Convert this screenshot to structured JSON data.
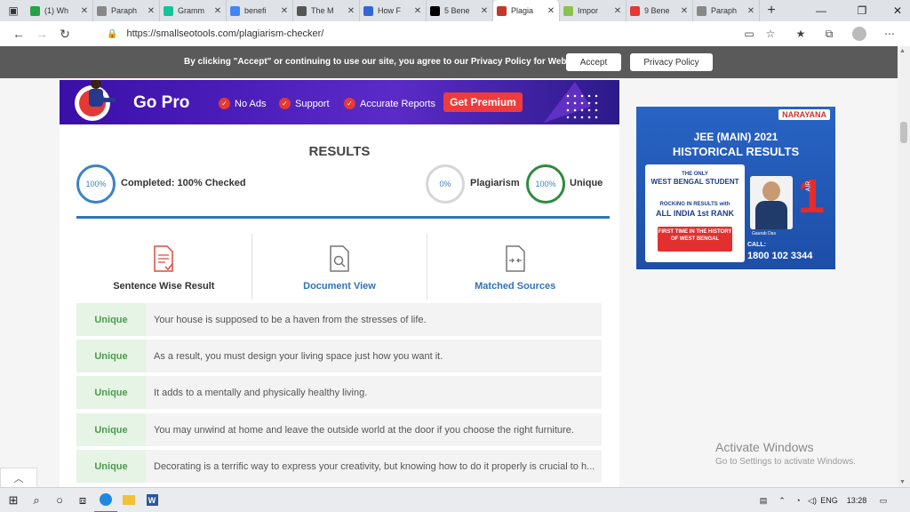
{
  "browser": {
    "tabs": [
      {
        "label": "(1) Wh",
        "favicon": "whatsapp-icon",
        "color": "#25a244"
      },
      {
        "label": "Paraph",
        "favicon": "quill-icon",
        "color": "#888888"
      },
      {
        "label": "Gramm",
        "favicon": "grammarly-icon",
        "color": "#15c39a"
      },
      {
        "label": "benefi",
        "favicon": "google-icon",
        "color": "#4285f4"
      },
      {
        "label": "The M",
        "favicon": "news-icon",
        "color": "#555555"
      },
      {
        "label": "How F",
        "favicon": "globe-icon",
        "color": "#3367d6"
      },
      {
        "label": "5 Bene",
        "favicon": "medium-icon",
        "color": "#000000"
      },
      {
        "label": "Plagia",
        "favicon": "sst-icon",
        "color": "#c0392b"
      },
      {
        "label": "Impor",
        "favicon": "page-icon",
        "color": "#8bc34a"
      },
      {
        "label": "9 Bene",
        "favicon": "target-icon",
        "color": "#e53935"
      },
      {
        "label": "Paraph",
        "favicon": "quill-icon",
        "color": "#888888"
      }
    ],
    "active_tab": 7,
    "new_tab": "+",
    "url": "https://smallseotools.com/plagiarism-checker/"
  },
  "cookie": {
    "message": "By clicking \"Accept\" or continuing to use our site, you agree to our Privacy Policy for Website",
    "accept": "Accept",
    "privacy": "Privacy Policy"
  },
  "gopro": {
    "title": "Go Pro",
    "features": [
      "No Ads",
      "Support",
      "Accurate Reports"
    ],
    "button": "Get Premium"
  },
  "results": {
    "heading": "RESULTS",
    "completed_pct": "100%",
    "completed_label": "Completed: 100% Checked",
    "plagiarism_pct": "0%",
    "plagiarism_label": "Plagiarism",
    "unique_pct": "100%",
    "unique_label": "Unique",
    "views": [
      "Sentence Wise Result",
      "Document View",
      "Matched Sources"
    ],
    "rows": [
      {
        "status": "Unique",
        "text": "Your house is supposed to be a haven from the stresses of life."
      },
      {
        "status": "Unique",
        "text": "As a result, you must design your living space just how you want it."
      },
      {
        "status": "Unique",
        "text": "It adds to a mentally and physically healthy living."
      },
      {
        "status": "Unique",
        "text": "You may unwind at home and leave the outside world at the door if you choose the right furniture."
      },
      {
        "status": "Unique",
        "text": "Decorating is a terrific way to express your creativity, but knowing how to do it properly is crucial to h..."
      }
    ]
  },
  "ad": {
    "brand": "NARAYANA",
    "headline1": "JEE (MAIN) 2021",
    "headline2": "HISTORICAL RESULTS",
    "line1": "THE ONLY",
    "line2": "WEST BENGAL STUDENT",
    "line3": "ROCKING IN RESULTS with",
    "line4": "ALL INDIA 1st RANK",
    "line5": "FIRST TIME IN THE HISTORY OF WEST BENGAL",
    "rank": "1",
    "rank_label": "AIR",
    "student": "Gaurab Das",
    "call": "CALL:",
    "phone": "1800 102 3344"
  },
  "watermark": {
    "title": "Activate Windows",
    "subtitle": "Go to Settings to activate Windows."
  },
  "taskbar": {
    "lang": "ENG",
    "time": "13:28"
  }
}
